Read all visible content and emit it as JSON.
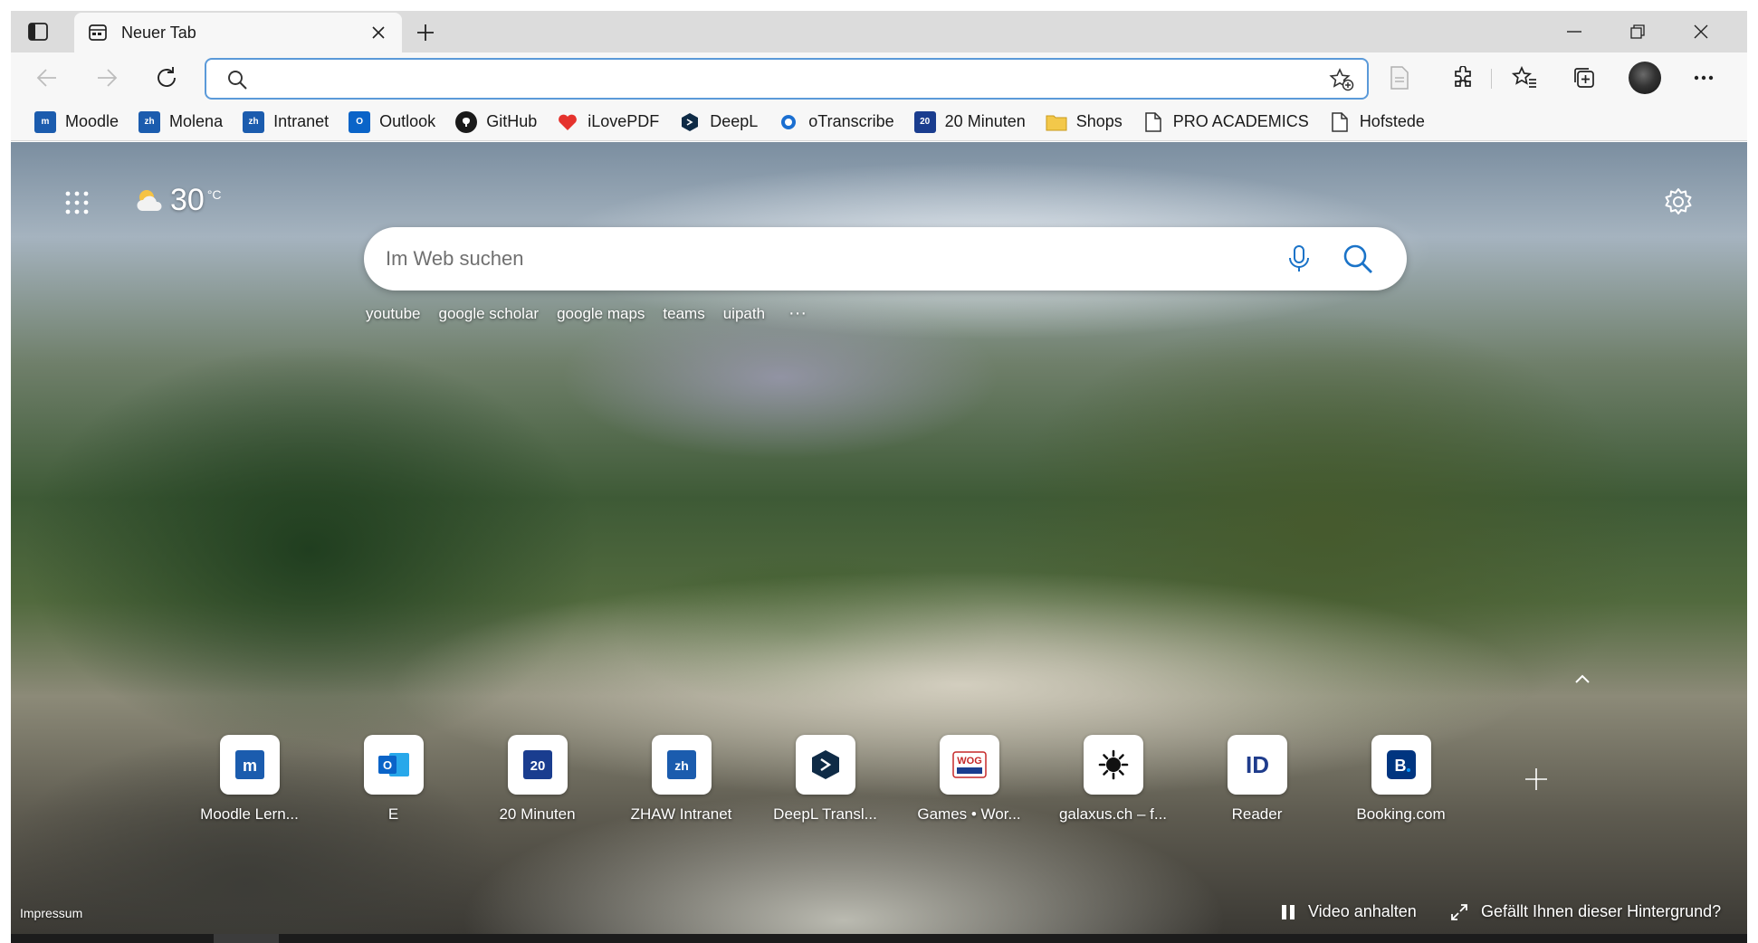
{
  "tab": {
    "title": "Neuer Tab"
  },
  "address_bar": {
    "value": "",
    "placeholder": ""
  },
  "bookmarks": [
    {
      "label": "Moodle",
      "icon": "moodle-icon",
      "color": "#1b5cae"
    },
    {
      "label": "Molena",
      "icon": "zhaw-icon",
      "color": "#1b5cae"
    },
    {
      "label": "Intranet",
      "icon": "zhaw-icon",
      "color": "#1b5cae"
    },
    {
      "label": "Outlook",
      "icon": "outlook-icon",
      "color": "#0a64c8"
    },
    {
      "label": "GitHub",
      "icon": "github-icon",
      "color": "#1a1a1a"
    },
    {
      "label": "iLovePDF",
      "icon": "heart-icon",
      "color": "#e5322d"
    },
    {
      "label": "DeepL",
      "icon": "deepl-icon",
      "color": "#0f2b46"
    },
    {
      "label": "oTranscribe",
      "icon": "otranscribe-icon",
      "color": "#1b6fd1"
    },
    {
      "label": "20 Minuten",
      "icon": "20min-icon",
      "color": "#1a3d8f"
    },
    {
      "label": "Shops",
      "icon": "folder-icon",
      "color": "#e8b22a"
    },
    {
      "label": "PRO ACADEMICS",
      "icon": "page-icon",
      "color": "#333333"
    },
    {
      "label": "Hofstede",
      "icon": "page-icon",
      "color": "#333333"
    }
  ],
  "weather": {
    "temp": "30",
    "unit": "°C"
  },
  "search": {
    "placeholder": "Im Web suchen"
  },
  "trending": [
    "youtube",
    "google scholar",
    "google maps",
    "teams",
    "uipath"
  ],
  "trending_more": "···",
  "tiles": [
    {
      "label": "Moodle Lern...",
      "icon": "moodle-icon",
      "glyph": "m",
      "color": "#1b5cae"
    },
    {
      "label": "E",
      "icon": "outlook-icon",
      "glyph": "O",
      "color": "#0a64c8"
    },
    {
      "label": "20 Minuten",
      "icon": "20min-icon",
      "glyph": "20",
      "color": "#1a3d8f"
    },
    {
      "label": "ZHAW Intranet",
      "icon": "zhaw-icon",
      "glyph": "zh",
      "color": "#1b5cae"
    },
    {
      "label": "DeepL Transl...",
      "icon": "deepl-icon",
      "glyph": ">",
      "color": "#0f2b46"
    },
    {
      "label": "Games • Wor...",
      "icon": "wog-icon",
      "glyph": "WOG",
      "color": "#c62828"
    },
    {
      "label": "galaxus.ch – f...",
      "icon": "galaxus-icon",
      "glyph": "✹",
      "color": "#111111"
    },
    {
      "label": "Reader",
      "icon": "id-icon",
      "glyph": "ID",
      "color": "#1f3c8c"
    },
    {
      "label": "Booking.com",
      "icon": "booking-icon",
      "glyph": "B.",
      "color": "#003580"
    }
  ],
  "footer": {
    "impressum": "Impressum",
    "video_pause": "Video anhalten",
    "like_background": "Gefällt Ihnen dieser Hintergrund?"
  }
}
